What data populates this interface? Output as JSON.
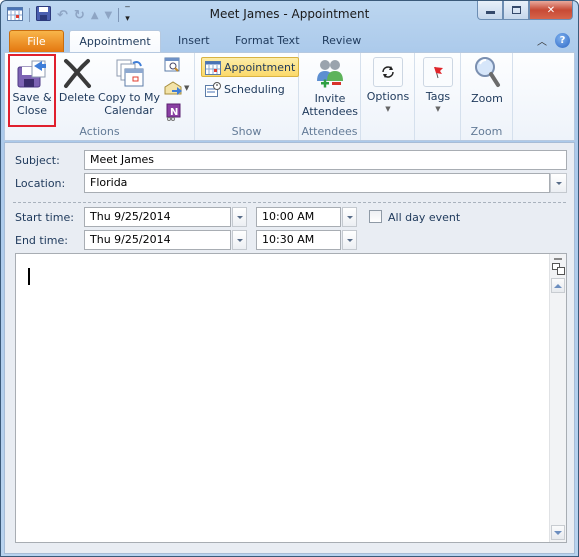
{
  "window": {
    "title": "Meet James  -  Appointment",
    "controls": {
      "minimize": "minimize",
      "maximize": "maximize",
      "close": "close"
    }
  },
  "quick_access": [
    "calendar-icon",
    "save-icon",
    "undo-icon",
    "redo-icon",
    "previous-item-icon",
    "next-item-icon",
    "customize-qat-icon"
  ],
  "tabs": [
    {
      "label": "File"
    },
    {
      "label": "Appointment",
      "active": true
    },
    {
      "label": "Insert"
    },
    {
      "label": "Format Text"
    },
    {
      "label": "Review"
    }
  ],
  "ribbon": {
    "groups": {
      "actions": {
        "label": "Actions",
        "save_close": "Save &\nClose",
        "save_line1": "Save &",
        "save_line2": "Close",
        "delete": "Delete",
        "copy_line1": "Copy to My",
        "copy_line2": "Calendar"
      },
      "show": {
        "label": "Show",
        "appointment": "Appointment",
        "scheduling": "Scheduling"
      },
      "attendees": {
        "label": "Attendees",
        "invite_line1": "Invite",
        "invite_line2": "Attendees"
      },
      "options": {
        "label": "Options"
      },
      "tags": {
        "label": "Tags"
      },
      "zoom": {
        "label": "Zoom",
        "button": "Zoom"
      }
    }
  },
  "form": {
    "subject_label": "Subject:",
    "subject_value": "Meet James",
    "location_label": "Location:",
    "location_value": "Florida",
    "start_label": "Start time:",
    "start_date": "Thu 9/25/2014",
    "start_time": "10:00 AM",
    "end_label": "End time:",
    "end_date": "Thu 9/25/2014",
    "end_time": "10:30 AM",
    "all_day_label": "All day event",
    "all_day_checked": false,
    "body_text": ""
  },
  "colors": {
    "file_tab": "#e4760f",
    "highlight_border": "#e01f2d",
    "selected_button": "#fbd96a"
  }
}
